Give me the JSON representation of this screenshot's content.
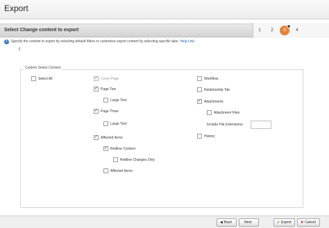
{
  "window": {
    "title": "Export"
  },
  "header": {
    "title": "Select Change content to export"
  },
  "steps": [
    {
      "label": "1",
      "active": false
    },
    {
      "label": "2",
      "active": false
    },
    {
      "label": "3",
      "active": true
    },
    {
      "label": "4",
      "active": false
    }
  ],
  "info": {
    "text": "Specify the content to export by selecting default filters or customize export content by selecting specific tabs.",
    "link": "Help Link"
  },
  "cursor_glyph": "I",
  "group": {
    "legend": "Custom Select Content"
  },
  "options": {
    "select_all": {
      "label": "Select All",
      "checked": false
    },
    "cover_page": {
      "label": "Cover Page",
      "checked": true,
      "disabled": true
    },
    "page_two": {
      "label": "Page Two",
      "checked": true
    },
    "page_two_large_text": {
      "label": "Large Text",
      "checked": false
    },
    "page_three": {
      "label": "Page Three",
      "checked": true
    },
    "page_three_large_text": {
      "label": "Large Text",
      "checked": false
    },
    "affected_items": {
      "label": "Affected Items",
      "checked": true
    },
    "redline_content": {
      "label": "Redline Content",
      "checked": true
    },
    "redline_changes_only": {
      "label": "Redline Changes Only",
      "checked": false
    },
    "affected_items_sub": {
      "label": "Affected Items",
      "checked": false
    },
    "workflow": {
      "label": "Workflow",
      "checked": false
    },
    "relationship_tab": {
      "label": "Relationship Tab",
      "checked": false
    },
    "attachments": {
      "label": "Attachments",
      "checked": true
    },
    "attachment_files": {
      "label": "Attachment Files",
      "checked": false
    },
    "include_file_extensions": {
      "label": "Include File Extensions:",
      "value": ""
    },
    "history": {
      "label": "History",
      "checked": false
    }
  },
  "footer": {
    "back": "Back",
    "next": "Next",
    "export": "Export",
    "cancel": "Cancel"
  }
}
